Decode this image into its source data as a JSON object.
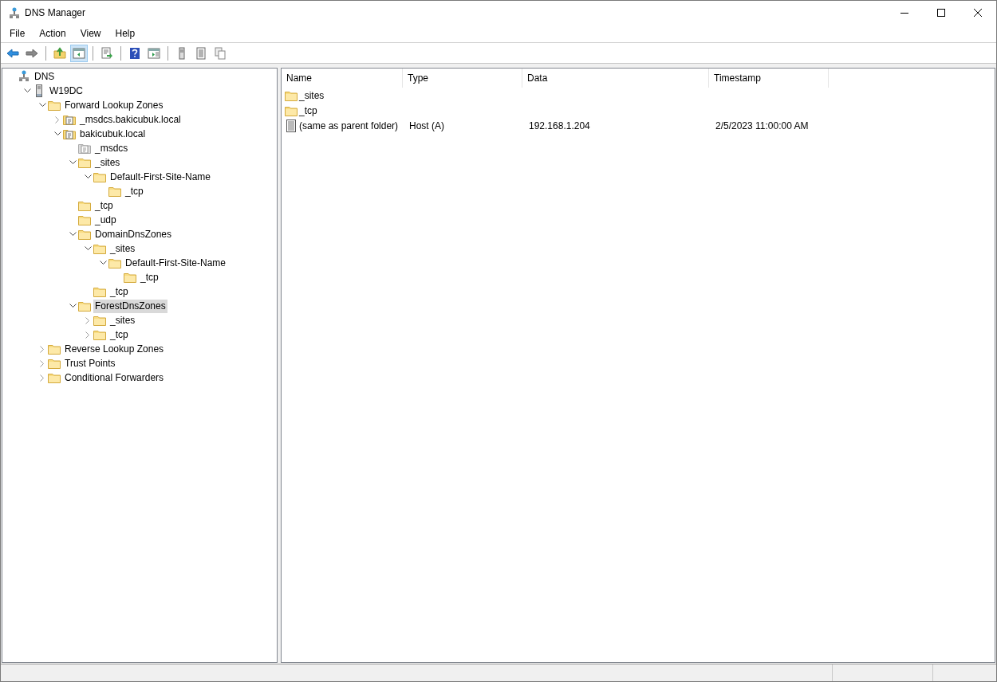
{
  "window": {
    "title": "DNS Manager"
  },
  "menu": [
    "File",
    "Action",
    "View",
    "Help"
  ],
  "toolbar": [
    [
      {
        "kind": "back",
        "pressed": false
      },
      {
        "kind": "forward",
        "pressed": false
      }
    ],
    [
      {
        "kind": "up",
        "pressed": false
      },
      {
        "kind": "tree",
        "pressed": true
      }
    ],
    [
      {
        "kind": "export",
        "pressed": false
      }
    ],
    [
      {
        "kind": "help",
        "pressed": false
      },
      {
        "kind": "pane",
        "pressed": false
      }
    ],
    [
      {
        "kind": "server",
        "pressed": false
      },
      {
        "kind": "list",
        "pressed": false
      },
      {
        "kind": "copy",
        "pressed": false
      }
    ]
  ],
  "tree": [
    {
      "label": "DNS",
      "kind": "dns",
      "selected": false,
      "children": [
        {
          "label": "W19DC",
          "kind": "server",
          "expanded": true,
          "selected": false,
          "children": [
            {
              "label": "Forward Lookup Zones",
              "kind": "folder",
              "expanded": true,
              "selected": false,
              "children": [
                {
                  "label": "_msdcs.bakicubuk.local",
                  "kind": "zone",
                  "expanded": false,
                  "selected": false
                },
                {
                  "label": "bakicubuk.local",
                  "kind": "zone",
                  "expanded": true,
                  "selected": false,
                  "children": [
                    {
                      "label": "_msdcs",
                      "kind": "delegation",
                      "selected": false
                    },
                    {
                      "label": "_sites",
                      "kind": "folder",
                      "expanded": true,
                      "selected": false,
                      "children": [
                        {
                          "label": "Default-First-Site-Name",
                          "kind": "folder",
                          "expanded": true,
                          "selected": false,
                          "children": [
                            {
                              "label": "_tcp",
                              "kind": "folder",
                              "selected": false
                            }
                          ]
                        }
                      ]
                    },
                    {
                      "label": "_tcp",
                      "kind": "folder",
                      "selected": false
                    },
                    {
                      "label": "_udp",
                      "kind": "folder",
                      "selected": false
                    },
                    {
                      "label": "DomainDnsZones",
                      "kind": "folder",
                      "expanded": true,
                      "selected": false,
                      "children": [
                        {
                          "label": "_sites",
                          "kind": "folder",
                          "expanded": true,
                          "selected": false,
                          "children": [
                            {
                              "label": "Default-First-Site-Name",
                              "kind": "folder",
                              "expanded": true,
                              "selected": false,
                              "children": [
                                {
                                  "label": "_tcp",
                                  "kind": "folder",
                                  "selected": false
                                }
                              ]
                            }
                          ]
                        },
                        {
                          "label": "_tcp",
                          "kind": "folder",
                          "selected": false
                        }
                      ]
                    },
                    {
                      "label": "ForestDnsZones",
                      "kind": "folder",
                      "expanded": true,
                      "selected": true,
                      "children": [
                        {
                          "label": "_sites",
                          "kind": "folder",
                          "expanded": false,
                          "selected": false
                        },
                        {
                          "label": "_tcp",
                          "kind": "folder",
                          "expanded": false,
                          "selected": false
                        }
                      ]
                    }
                  ]
                }
              ]
            },
            {
              "label": "Reverse Lookup Zones",
              "kind": "folder",
              "expanded": false,
              "selected": false
            },
            {
              "label": "Trust Points",
              "kind": "folder",
              "expanded": false,
              "selected": false
            },
            {
              "label": "Conditional Forwarders",
              "kind": "folder",
              "expanded": false,
              "selected": false
            }
          ]
        }
      ]
    }
  ],
  "list": {
    "columns": [
      "Name",
      "Type",
      "Data",
      "Timestamp"
    ],
    "rows": [
      {
        "kind": "folder",
        "cells": [
          "_sites"
        ]
      },
      {
        "kind": "folder",
        "cells": [
          "_tcp"
        ]
      },
      {
        "kind": "record",
        "cells": [
          "(same as parent folder)",
          "Host (A)",
          "192.168.1.204",
          "2/5/2023 11:00:00 AM"
        ]
      }
    ]
  }
}
